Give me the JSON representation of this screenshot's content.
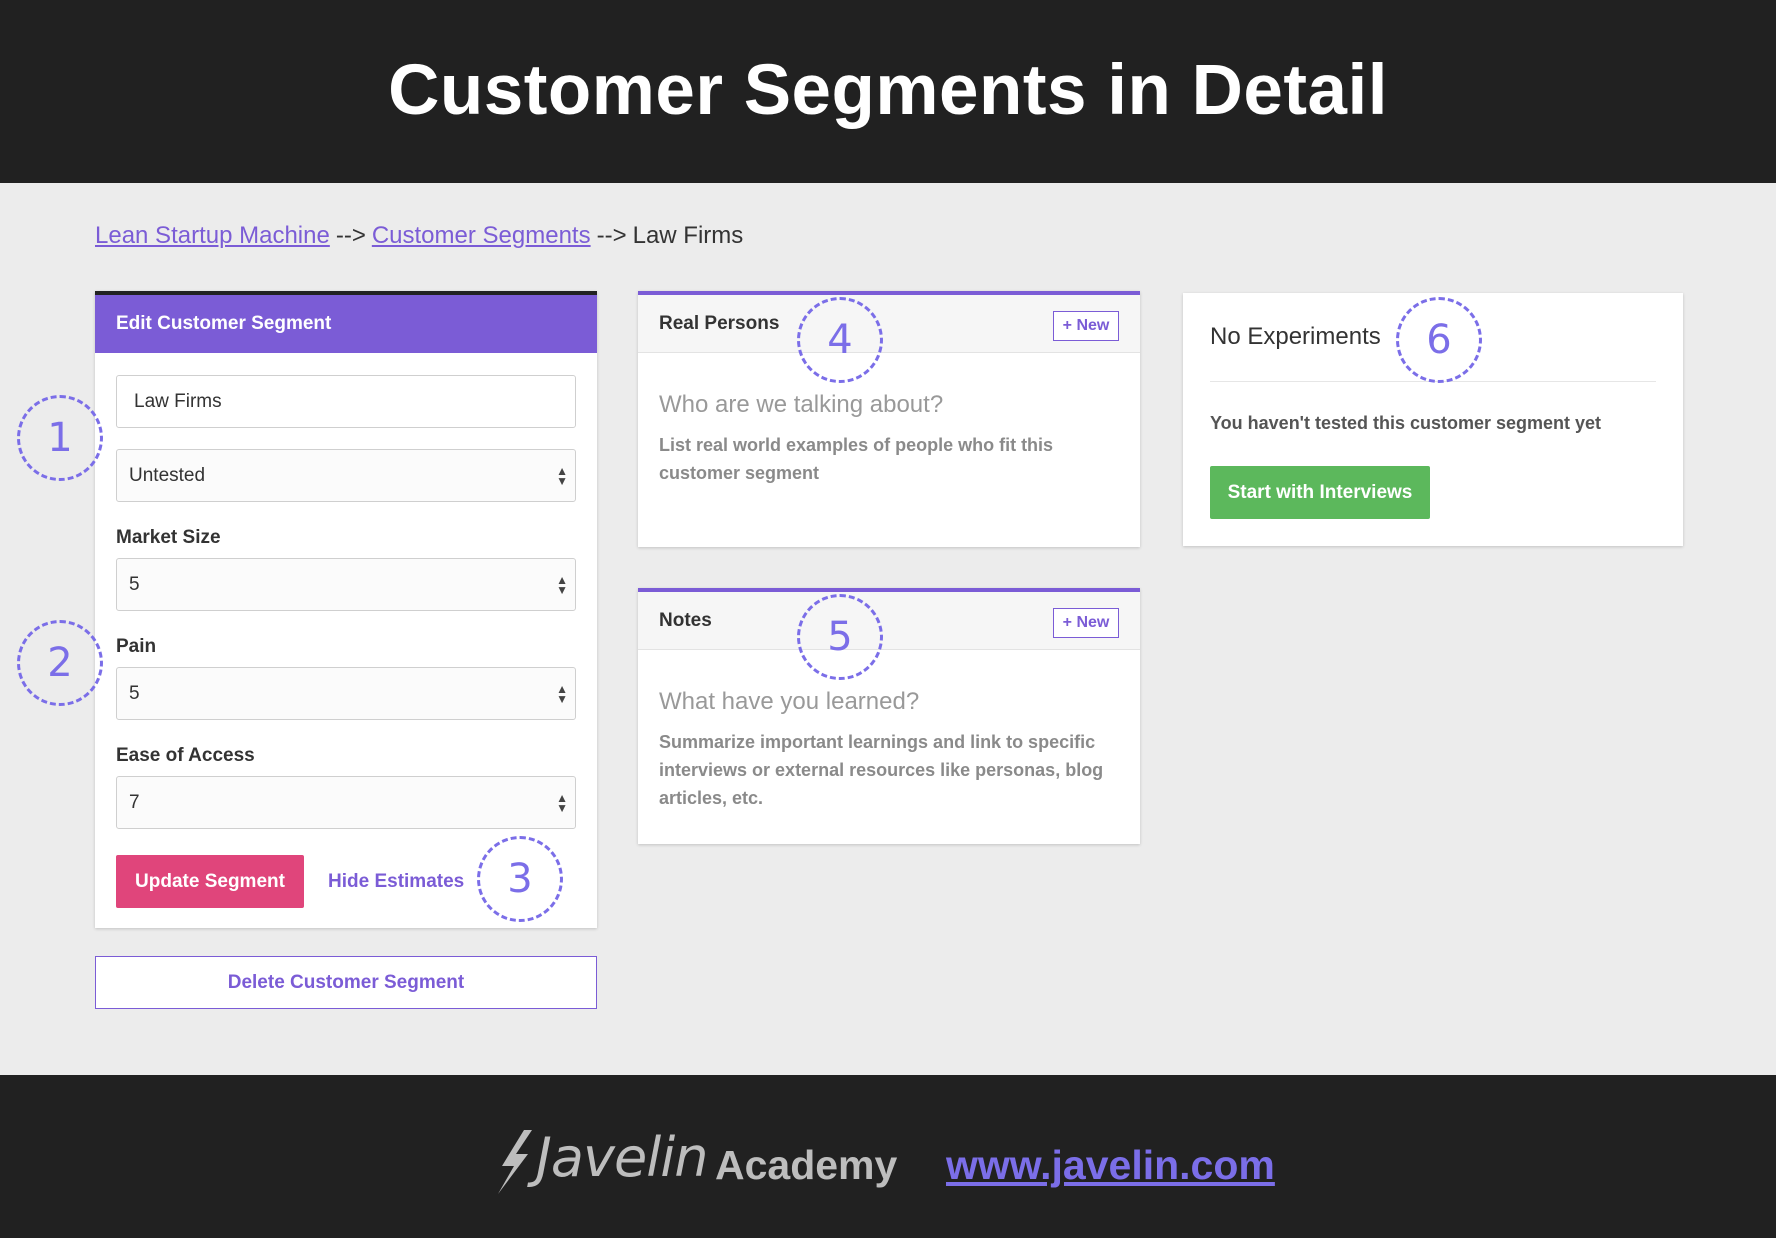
{
  "banner": {
    "title": "Customer Segments in Detail"
  },
  "breadcrumb": {
    "items": [
      {
        "label": "Lean Startup Machine",
        "link": true
      },
      {
        "label": "Customer Segments",
        "link": true
      },
      {
        "label": "Law Firms",
        "link": false
      }
    ],
    "separator": "-->"
  },
  "edit_segment": {
    "header": "Edit Customer Segment",
    "name_value": "Law Firms",
    "status_value": "Untested",
    "market_size": {
      "label": "Market Size",
      "value": "5"
    },
    "pain": {
      "label": "Pain",
      "value": "5"
    },
    "ease_of_access": {
      "label": "Ease of Access",
      "value": "7"
    },
    "update_button": "Update Segment",
    "hide_estimates_link": "Hide Estimates"
  },
  "delete_button": "Delete Customer Segment",
  "real_persons": {
    "title": "Real Persons",
    "new_button": "+ New",
    "question": "Who are we talking about?",
    "description": "List real world examples of people who fit this customer segment"
  },
  "notes": {
    "title": "Notes",
    "new_button": "+ New",
    "question": "What have you learned?",
    "description": "Summarize important learnings and link to specific interviews or external resources like personas, blog articles, etc."
  },
  "experiments": {
    "title": "No Experiments",
    "description": "You haven't tested this customer segment yet",
    "start_button": "Start with Interviews"
  },
  "annotations": [
    "1",
    "2",
    "3",
    "4",
    "5",
    "6"
  ],
  "footer": {
    "logo_word": "Javelin",
    "logo_suffix": "Academy",
    "url": "www.javelin.com"
  },
  "colors": {
    "accent_purple": "#7b5cd6",
    "annotation_purple": "#7b6ee8",
    "update_pink": "#e0457b",
    "start_green": "#5cb85c",
    "banner_dark": "#212121"
  }
}
